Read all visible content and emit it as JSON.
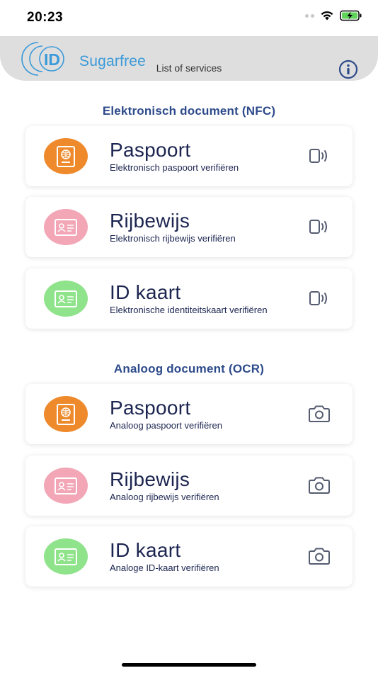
{
  "status_bar": {
    "time": "20:23"
  },
  "header": {
    "logo_text": "Sugarfree",
    "logo_id": "ID",
    "title": "List of services"
  },
  "colors": {
    "orange": "#ee8a2b",
    "pink": "#f2a6b6",
    "green": "#8fe38a",
    "section_title": "#2d4a8a",
    "text": "#1c2550"
  },
  "sections": [
    {
      "title": "Elektronisch document (NFC)",
      "items": [
        {
          "title": "Paspoort",
          "subtitle": "Elektronisch paspoort verifiëren",
          "icon": "passport-icon",
          "action_icon": "nfc-icon"
        },
        {
          "title": "Rijbewijs",
          "subtitle": "Elektronisch rijbewijs verifiëren",
          "icon": "id-card-icon",
          "action_icon": "nfc-icon"
        },
        {
          "title": "ID kaart",
          "subtitle": "Elektronische identiteitskaart verifiëren",
          "icon": "id-card-icon",
          "action_icon": "nfc-icon"
        }
      ]
    },
    {
      "title": "Analoog document (OCR)",
      "items": [
        {
          "title": "Paspoort",
          "subtitle": "Analoog paspoort verifiëren",
          "icon": "passport-icon",
          "action_icon": "camera-icon"
        },
        {
          "title": "Rijbewijs",
          "subtitle": "Analoog rijbewijs verifiëren",
          "icon": "id-card-icon",
          "action_icon": "camera-icon"
        },
        {
          "title": "ID kaart",
          "subtitle": "Analoge ID-kaart verifiëren",
          "icon": "id-card-icon",
          "action_icon": "camera-icon"
        }
      ]
    }
  ]
}
